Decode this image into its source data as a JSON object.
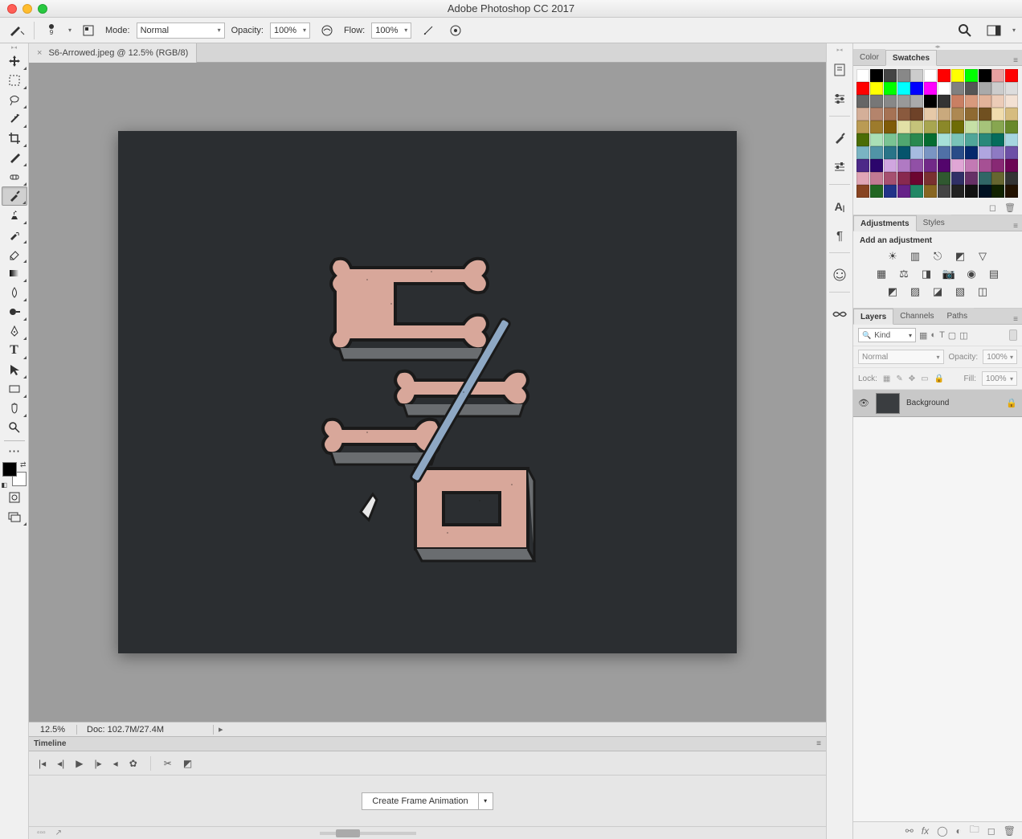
{
  "app": {
    "title": "Adobe Photoshop CC 2017"
  },
  "options": {
    "mode_label": "Mode:",
    "mode_value": "Normal",
    "opacity_label": "Opacity:",
    "opacity_value": "100%",
    "flow_label": "Flow:",
    "flow_value": "100%",
    "brush_size": "9"
  },
  "document": {
    "tab_label": "S6-Arrowed.jpeg @ 12.5% (RGB/8)",
    "zoom": "12.5%",
    "doc_info": "Doc: 102.7M/27.4M"
  },
  "timeline": {
    "title": "Timeline",
    "create_btn": "Create Frame Animation"
  },
  "panels": {
    "color_tab": "Color",
    "swatches_tab": "Swatches",
    "adjustments_tab": "Adjustments",
    "styles_tab": "Styles",
    "add_adjustment": "Add an adjustment",
    "layers_tab": "Layers",
    "channels_tab": "Channels",
    "paths_tab": "Paths",
    "kind_label": "Kind",
    "blend_mode": "Normal",
    "opacity_label": "Opacity:",
    "opacity_value": "100%",
    "lock_label": "Lock:",
    "fill_label": "Fill:",
    "fill_value": "100%",
    "layer_name": "Background"
  },
  "swatches": [
    "#ffffff",
    "#000000",
    "#444444",
    "#888888",
    "#cccccc",
    "#ffffff",
    "#ff0000",
    "#ffff00",
    "#00ff00",
    "#000000",
    "#e8a0a0",
    "#ff0000",
    "#ff0000",
    "#ffff00",
    "#00ff00",
    "#00ffff",
    "#0000ff",
    "#ff00ff",
    "#ffffff",
    "#808080",
    "#555555",
    "#aaaaaa",
    "#cccccc",
    "#dddddd",
    "#666666",
    "#777777",
    "#888888",
    "#999999",
    "#aaaaaa",
    "#000000",
    "#333333",
    "#c97f63",
    "#d89a7d",
    "#e2b39a",
    "#ecccb8",
    "#f3e1d3",
    "#d4af99",
    "#b4846c",
    "#a67254",
    "#8a5a3e",
    "#6e4228",
    "#e6c9a8",
    "#c9a97d",
    "#ad8852",
    "#8f6a32",
    "#705020",
    "#f0dcad",
    "#d6bc7f",
    "#ba9b54",
    "#9d7b2c",
    "#7f5b08",
    "#e2e0a6",
    "#c5c37a",
    "#a8a650",
    "#8b8829",
    "#6e6c05",
    "#c6e0a6",
    "#a6c37a",
    "#87a650",
    "#688829",
    "#4a6c05",
    "#a9e0b6",
    "#7ac393",
    "#50a670",
    "#29884f",
    "#056c30",
    "#a6e0d8",
    "#7ac3b8",
    "#50a699",
    "#29887a",
    "#056c5c",
    "#a6d5e0",
    "#7ab4c3",
    "#5094a6",
    "#297488",
    "#05546c",
    "#a6bbe0",
    "#7a95c3",
    "#5070a6",
    "#294c88",
    "#05286c",
    "#b0a6e0",
    "#8e7ac3",
    "#6d50a6",
    "#4c2988",
    "#2b056c",
    "#d0a6e0",
    "#b07ac3",
    "#9150a6",
    "#722988",
    "#53056c",
    "#e0a6d5",
    "#c37ab4",
    "#a65094",
    "#882974",
    "#6c0554",
    "#e0a6b6",
    "#c37a93",
    "#a65070",
    "#88294f",
    "#6c0530",
    "#7a3030",
    "#305830",
    "#303066",
    "#663066",
    "#306666",
    "#666630",
    "#333333",
    "#884422",
    "#226622",
    "#223388",
    "#662288",
    "#228866",
    "#886622",
    "#444444",
    "#222222",
    "#111111",
    "#001122",
    "#112200",
    "#221100"
  ]
}
